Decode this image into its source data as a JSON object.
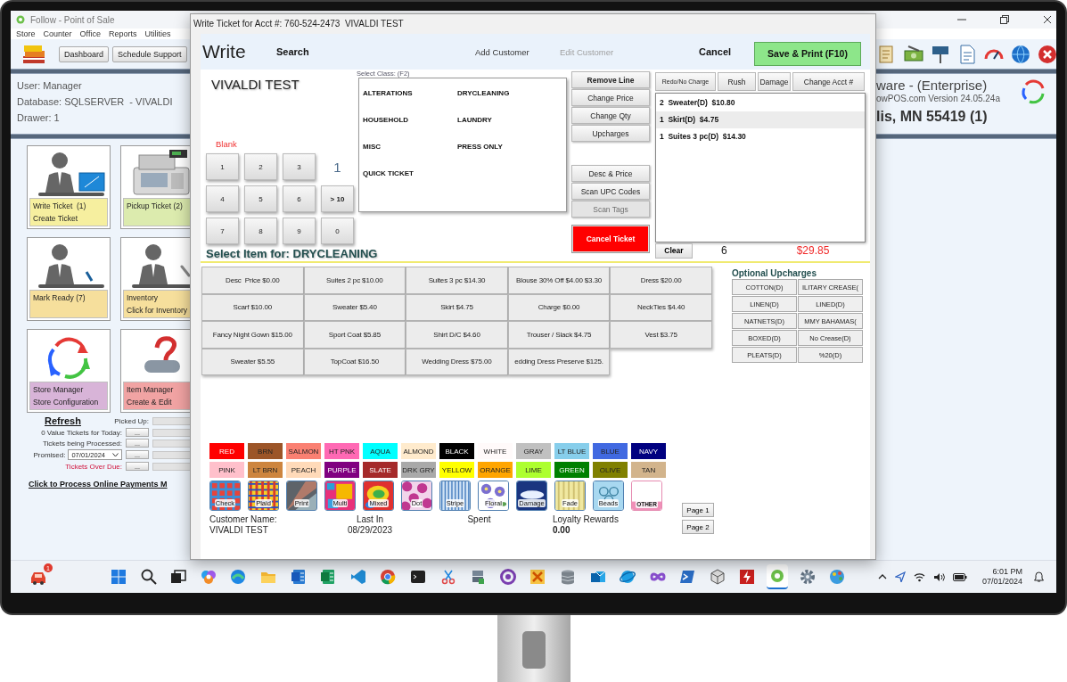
{
  "app": {
    "title": "Follow - Point of Sale",
    "menu": [
      "Store",
      "Counter",
      "Office",
      "Reports",
      "Utilities"
    ],
    "toolbar_buttons": [
      "Dashboard",
      "Schedule Support"
    ],
    "info": [
      "User: Manager",
      "Database: SQLSERVER  - VIVALDI",
      "Drawer: 1"
    ],
    "product_title": "ware - (Enterprise)",
    "version": "owPOS.com Version 24.05.24a",
    "location": "lis, MN 55419 (1)",
    "tiles": [
      {
        "kind": "write",
        "lines": [
          "Write Ticket  (1)",
          "Create Ticket"
        ],
        "color": "#f6ef9f"
      },
      {
        "kind": "pickup",
        "lines": [
          "Pickup Ticket (2)"
        ],
        "color": "#dcebae"
      },
      {
        "kind": "ready",
        "lines": [
          "Mark Ready (7)"
        ],
        "color": "#f6df9c"
      },
      {
        "kind": "inventory",
        "lines": [
          "Inventory",
          "Click for Inventory"
        ],
        "color": "#f6df9c"
      },
      {
        "kind": "manager",
        "lines": [
          "Store Manager",
          "Store Configuration"
        ],
        "color": "#d8b4d8"
      },
      {
        "kind": "items",
        "lines": [
          "Item Manager",
          "Create & Edit"
        ],
        "color": "#f1a3a3"
      }
    ],
    "refresh": "Refresh",
    "stats": [
      {
        "label": "Picked Up:",
        "kind": "bar",
        "alert": false
      },
      {
        "label": "0 Value Tickets for Today:",
        "kind": "button",
        "button": "...",
        "alert": false
      },
      {
        "label": "Tickets being Processed:",
        "kind": "button",
        "button": "...",
        "alert": false
      },
      {
        "label": "Promised:",
        "kind": "date",
        "value": "07/01/2024",
        "button": "...",
        "alert": false
      },
      {
        "label": "Tickets Over Due:",
        "kind": "button",
        "button": "...",
        "alert": true
      }
    ],
    "payments_link": "Click to Process Online Payments M"
  },
  "dialog": {
    "title": "Write Ticket for Acct #: 760-524-2473  VIVALDI TEST",
    "mode": "Write",
    "nav": [
      {
        "label": "Search",
        "kind": "strong",
        "disabled": false
      },
      {
        "label": "Add Customer",
        "kind": "plain",
        "disabled": false
      },
      {
        "label": "Edit Customer",
        "kind": "plain",
        "disabled": true
      },
      {
        "label": "Cancel",
        "kind": "strong",
        "disabled": false
      }
    ],
    "save_button": "Save & Print (F10)",
    "customer": "VIVALDI TEST",
    "blank": "Blank",
    "keypad": [
      [
        {
          "label": "1",
          "kind": "digit"
        },
        {
          "label": "2",
          "kind": "digit"
        },
        {
          "label": "3",
          "kind": "digit"
        }
      ],
      [
        {
          "label": "4",
          "kind": "digit"
        },
        {
          "label": "5",
          "kind": "digit"
        },
        {
          "label": "6",
          "kind": "digit"
        },
        {
          "label": "> 10",
          "kind": "more"
        }
      ],
      [
        {
          "label": "7",
          "kind": "digit"
        },
        {
          "label": "8",
          "kind": "digit"
        },
        {
          "label": "9",
          "kind": "digit"
        },
        {
          "label": "0",
          "kind": "digit"
        }
      ]
    ],
    "quantity": "1",
    "class_label": "Select Class: (F2)",
    "classes": [
      "ALTERATIONS",
      "DRYCLEANING",
      "HOUSEHOLD",
      "LAUNDRY",
      "MISC",
      "PRESS ONLY",
      "QUICK TICKET"
    ],
    "actions": [
      [
        {
          "label": "Remove Line",
          "kind": "strong",
          "disabled": false
        },
        {
          "label": "Change Price",
          "kind": "plain",
          "disabled": false
        },
        {
          "label": "Change Qty",
          "kind": "plain",
          "disabled": false
        },
        {
          "label": "Upcharges",
          "kind": "plain",
          "disabled": false
        }
      ],
      [
        {
          "label": "Desc & Price",
          "kind": "plain",
          "disabled": false
        },
        {
          "label": "Scan UPC Codes",
          "kind": "plain",
          "disabled": false
        },
        {
          "label": "Scan Tags",
          "kind": "plain",
          "disabled": true
        }
      ]
    ],
    "cancel_ticket": "Cancel Ticket",
    "ticket_buttons": [
      "Redo/No Charge",
      "Rush",
      "Damage",
      "Change Acct #"
    ],
    "lines": [
      {
        "text": "2  Sweater(D)  $10.80",
        "selected": false
      },
      {
        "text": "1  Skirt(D)  $4.75",
        "selected": true
      },
      {
        "text": "1  Suites 3 pc(D)  $14.30",
        "selected": false
      }
    ],
    "clear": "Clear",
    "count": "6",
    "total": "$29.85",
    "item_heading": "Select Item for: DRYCLEANING",
    "items": [
      "Desc  Price $0.00",
      "Suites 2 pc $10.00",
      "Suites 3 pc $14.30",
      "Blouse 30% Off $4.00 $3.30",
      "Dress $20.00",
      "Scarf $10.00",
      "Sweater $5.40",
      "Skirt $4.75",
      "Charge $0.00",
      "NeckTies $4.40",
      "Fancy Night Gown $15.00",
      "Sport Coat $5.85",
      "Shirt D/C $4.60",
      "Trouser / Slack $4.75",
      "Vest $3.75",
      "Sweater $5.55",
      "TopCoat $16.50",
      "Wedding Dress $75.00",
      "edding Dress Preserve $125."
    ],
    "upcharges_title": "Optional Upcharges",
    "upcharges": [
      "COTTON(D)",
      "ILITARY CREASE(",
      "LINEN(D)",
      "LINED(D)",
      "NATNETS(D)",
      "MMY BAHAMAS(",
      "BOXED(D)",
      "No Crease(D)",
      "PLEATS(D)",
      "%20(D)"
    ],
    "colors": [
      {
        "label": "RED",
        "color": "#ff0000"
      },
      {
        "label": "BRN",
        "color": "#9c5528"
      },
      {
        "label": "SALMON",
        "color": "#fa8072"
      },
      {
        "label": "HT PNK",
        "color": "#ff69b4"
      },
      {
        "label": "AQUA",
        "color": "#00ffff"
      },
      {
        "label": "ALMOND",
        "color": "#ffebcd"
      },
      {
        "label": "BLACK",
        "color": "#000000"
      },
      {
        "label": "WHITE",
        "color": "#fffafa"
      },
      {
        "label": "GRAY",
        "color": "#c0c0c0"
      },
      {
        "label": "LT BLUE",
        "color": "#87ceeb"
      },
      {
        "label": "BLUE",
        "color": "#4169e1"
      },
      {
        "label": "NAVY",
        "color": "#000080"
      },
      {
        "label": "PINK",
        "color": "#ffc0cb"
      },
      {
        "label": "LT BRN",
        "color": "#cd853f"
      },
      {
        "label": "PEACH",
        "color": "#ffdab9"
      },
      {
        "label": "PURPLE",
        "color": "#800080"
      },
      {
        "label": "SLATE",
        "color": "#a52a2a"
      },
      {
        "label": "DRK GRY",
        "color": "#a9a9a9"
      },
      {
        "label": "YELLOW",
        "color": "#ffff00"
      },
      {
        "label": "ORANGE",
        "color": "#ffa500"
      },
      {
        "label": "LIME",
        "color": "#adff2f"
      },
      {
        "label": "GREEN",
        "color": "#008000"
      },
      {
        "label": "OLIVE",
        "color": "#808000"
      },
      {
        "label": "TAN",
        "color": "#d2b48c"
      }
    ],
    "patterns": [
      {
        "label": "Check",
        "kind": "check"
      },
      {
        "label": "Plaid",
        "kind": "plaid"
      },
      {
        "label": "Print",
        "kind": "print"
      },
      {
        "label": "Multi",
        "kind": "multi"
      },
      {
        "label": "Mixed",
        "kind": "mixed"
      },
      {
        "label": "Dot",
        "kind": "dot"
      },
      {
        "label": "Stripe",
        "kind": "stripe"
      },
      {
        "label": "Floral",
        "kind": "floral"
      },
      {
        "label": "Damage",
        "kind": "damage"
      },
      {
        "label": "Fade",
        "kind": "fade"
      },
      {
        "label": "Beads",
        "kind": "beads"
      },
      {
        "label": "OTHER",
        "kind": "other"
      }
    ],
    "summary": [
      {
        "label": "Customer Name:",
        "value": "VIVALDI TEST",
        "kind": "plain"
      },
      {
        "label": "Last In",
        "value": "08/29/2023",
        "kind": "plain"
      },
      {
        "label": "Spent"
      },
      {
        "label": "Loyalty Rewards",
        "value": "0.00",
        "kind": "total"
      }
    ],
    "pages": [
      "Page 1",
      "Page 2"
    ]
  },
  "taskbar": {
    "badge": "1",
    "time": "6:01 PM",
    "date": "07/01/2024",
    "apps": [
      {
        "kind": "start",
        "selected": false
      },
      {
        "kind": "search",
        "selected": false
      },
      {
        "kind": "taskview",
        "selected": false
      },
      {
        "kind": "swirl",
        "selected": false
      },
      {
        "kind": "wave",
        "selected": false
      },
      {
        "kind": "folder",
        "selected": false
      },
      {
        "kind": "document",
        "selected": false
      },
      {
        "kind": "sheet",
        "selected": false
      },
      {
        "kind": "ribbon",
        "selected": false
      },
      {
        "kind": "browser",
        "selected": false
      },
      {
        "kind": "terminal",
        "selected": false
      },
      {
        "kind": "scissors",
        "selected": false
      },
      {
        "kind": "server",
        "selected": false
      },
      {
        "kind": "ring",
        "selected": false
      },
      {
        "kind": "tools",
        "selected": false
      },
      {
        "kind": "database",
        "selected": false
      },
      {
        "kind": "mail",
        "selected": false
      },
      {
        "kind": "globe",
        "selected": false
      },
      {
        "kind": "infinity",
        "selected": false
      },
      {
        "kind": "prompt",
        "selected": false
      },
      {
        "kind": "cube",
        "selected": false
      },
      {
        "kind": "bolt",
        "selected": false
      },
      {
        "kind": "app",
        "selected": true
      },
      {
        "kind": "gear",
        "selected": false
      },
      {
        "kind": "palette",
        "selected": false
      }
    ]
  }
}
